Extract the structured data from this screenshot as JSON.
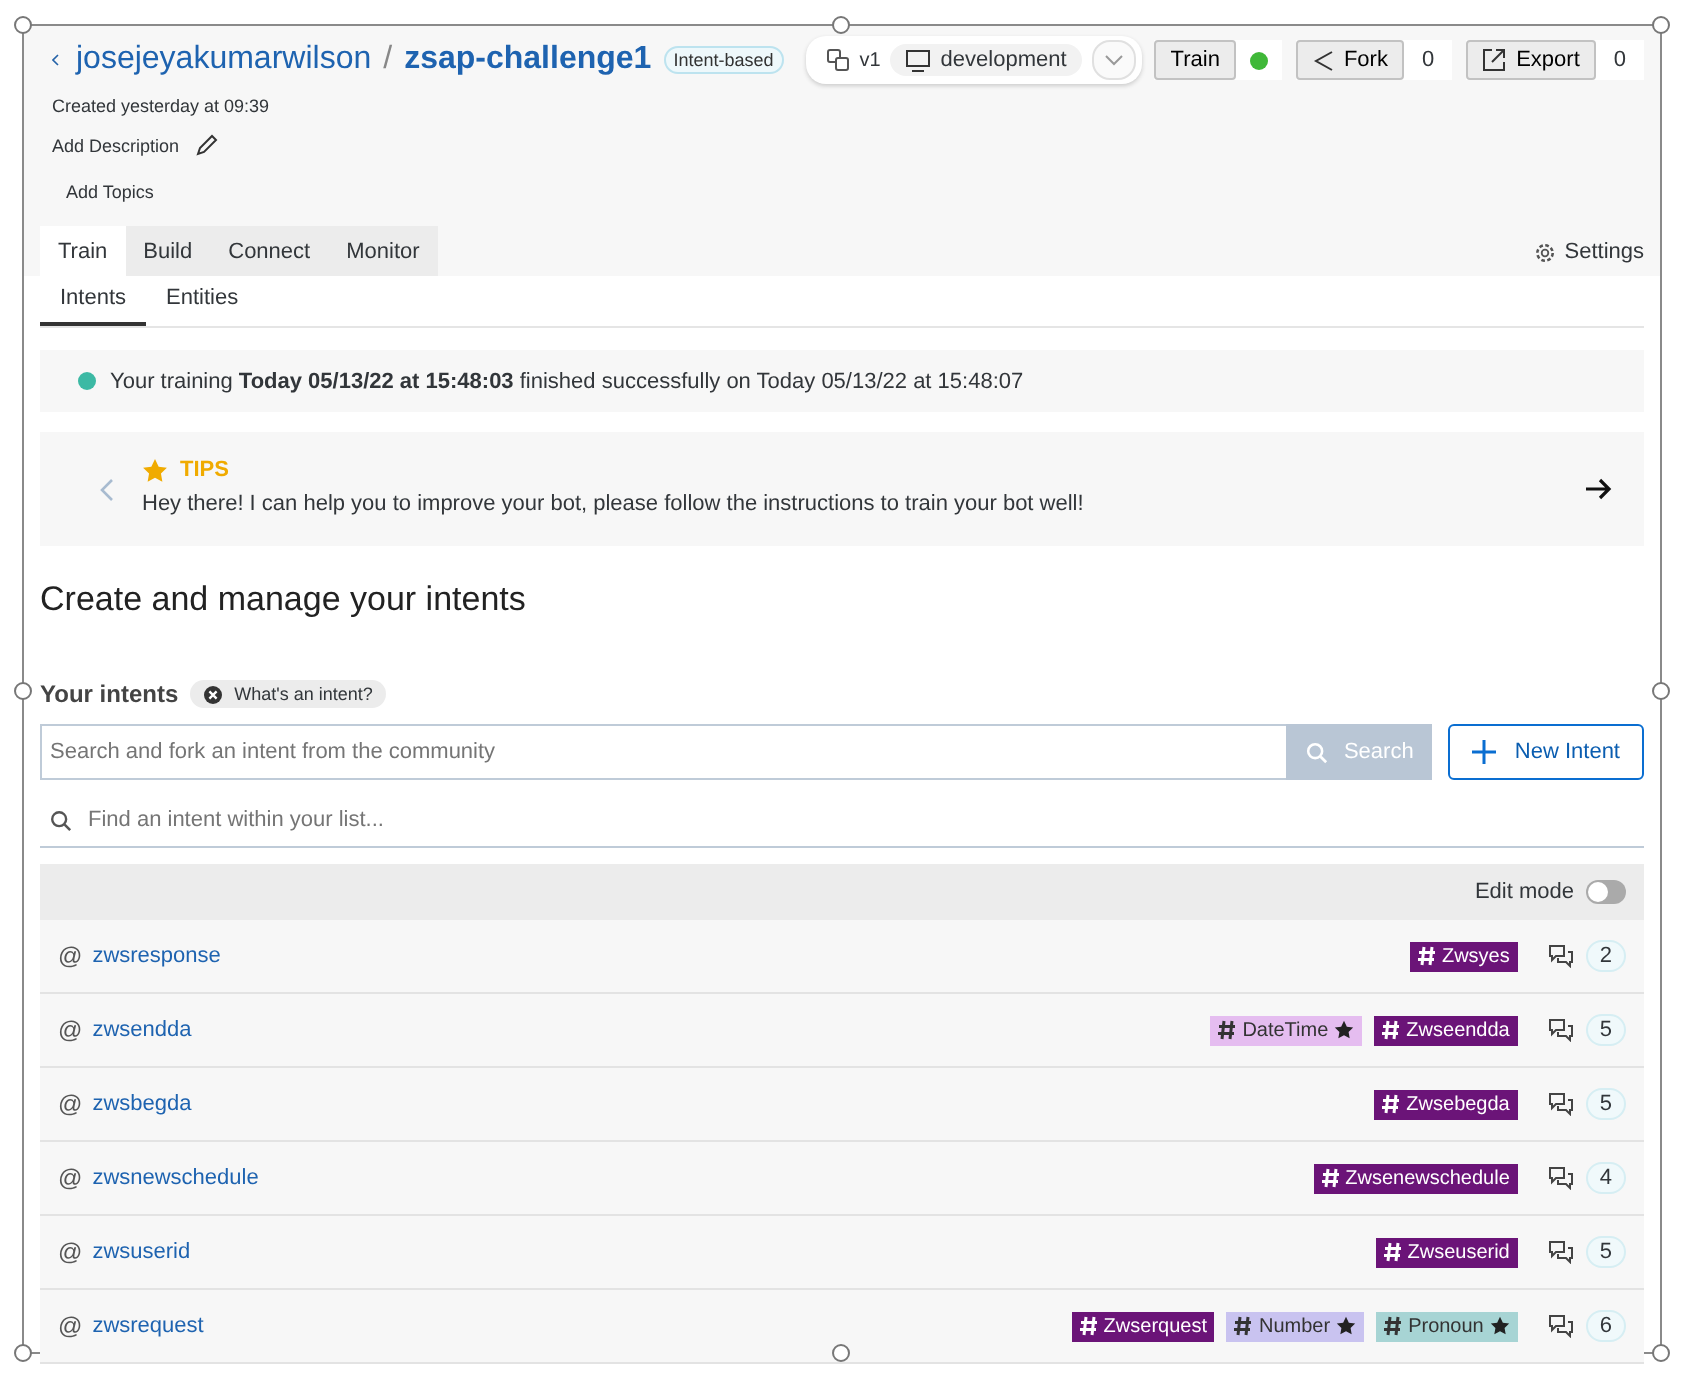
{
  "header": {
    "owner": "josejeyakumarwilson",
    "separator": "/",
    "bot_name": "zsap-challenge1",
    "bot_type": "Intent-based",
    "version": "v1",
    "environment": "development",
    "created": "Created yesterday at 09:39",
    "add_description": "Add Description",
    "add_topics": "Add Topics"
  },
  "actions": [
    {
      "label": "Train",
      "kind": "status",
      "color": "#3fb838"
    },
    {
      "label": "Fork",
      "kind": "count",
      "count": "0"
    },
    {
      "label": "Export",
      "kind": "count",
      "count": "0"
    }
  ],
  "tabs": [
    {
      "label": "Train",
      "selected": true
    },
    {
      "label": "Build",
      "selected": false
    },
    {
      "label": "Connect",
      "selected": false
    },
    {
      "label": "Monitor",
      "selected": false
    }
  ],
  "settings": "Settings",
  "subtabs": [
    {
      "label": "Intents",
      "selected": true
    },
    {
      "label": "Entities",
      "selected": false
    }
  ],
  "training_status": {
    "color": "#3cb9a4",
    "text": "Your training **Today 05/13/22 at 15:48:03** finished successfully on Today 05/13/22 at 15:48:07"
  },
  "tips": {
    "title": "TIPS",
    "text": "Hey there! I can help you to improve your bot, please follow the instructions to train your bot well!"
  },
  "heading": "Create and manage your intents",
  "intents_section": {
    "title": "Your intents",
    "help": "What's an intent?",
    "community_search": {
      "placeholder": "Search and fork an intent from the community",
      "button": "Search"
    },
    "new_button": "New Intent",
    "filter": {
      "placeholder": "Find an intent within your list..."
    },
    "edit_mode": {
      "label": "Edit mode",
      "on": false
    }
  },
  "intents": [
    {
      "prefix": "@",
      "name": "zwsresponse",
      "tags": [
        {
          "label": "Zwsyes",
          "kind": "intent",
          "color": "#6b1478"
        }
      ],
      "count": "2"
    },
    {
      "prefix": "@",
      "name": "zwsendda",
      "tags": [
        {
          "label": "DateTime",
          "kind": "entity",
          "color": "#e5bdf0"
        },
        {
          "label": "Zwseendda",
          "kind": "intent",
          "color": "#6b1478"
        }
      ],
      "count": "5"
    },
    {
      "prefix": "@",
      "name": "zwsbegda",
      "tags": [
        {
          "label": "Zwsebegda",
          "kind": "intent",
          "color": "#6b1478"
        }
      ],
      "count": "5"
    },
    {
      "prefix": "@",
      "name": "zwsnewschedule",
      "tags": [
        {
          "label": "Zwsenewschedule",
          "kind": "intent",
          "color": "#6b1478"
        }
      ],
      "count": "4"
    },
    {
      "prefix": "@",
      "name": "zwsuserid",
      "tags": [
        {
          "label": "Zwseuserid",
          "kind": "intent",
          "color": "#6b1478"
        }
      ],
      "count": "5"
    },
    {
      "prefix": "@",
      "name": "zwsrequest",
      "tags": [
        {
          "label": "Zwserquest",
          "kind": "intent",
          "color": "#6b1478"
        },
        {
          "label": "Number",
          "kind": "entity",
          "color": "#c9c3f0"
        },
        {
          "label": "Pronoun",
          "kind": "entity",
          "color": "#a7d4d4"
        }
      ],
      "count": "6"
    }
  ]
}
